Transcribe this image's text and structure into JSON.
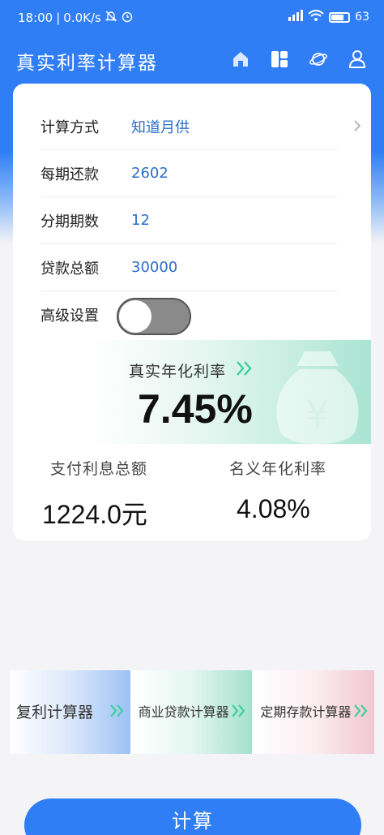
{
  "status_bar": {
    "time": "18:00",
    "speed": "0.0K/s",
    "battery": "63"
  },
  "app": {
    "title": "真实利率计算器"
  },
  "form": {
    "method_label": "计算方式",
    "method_value": "知道月供",
    "payment_label": "每期还款",
    "payment_value": "2602",
    "periods_label": "分期期数",
    "periods_value": "12",
    "loan_label": "贷款总额",
    "loan_value": "30000",
    "advanced_label": "高级设置"
  },
  "result": {
    "real_rate_label": "真实年化利率",
    "real_rate_value": "7.45%",
    "interest_label": "支付利息总额",
    "interest_value": "1224.0元",
    "nominal_label": "名义年化利率",
    "nominal_value": "4.08%"
  },
  "tiles": [
    {
      "label": "复利计算器"
    },
    {
      "label": "商业贷款计算器"
    },
    {
      "label": "定期存款计算器"
    }
  ],
  "button": {
    "calculate": "计算"
  },
  "colors": {
    "primary": "#2f7ef5",
    "value_text": "#2a6fc9",
    "accent_green": "#3fcf9a"
  }
}
